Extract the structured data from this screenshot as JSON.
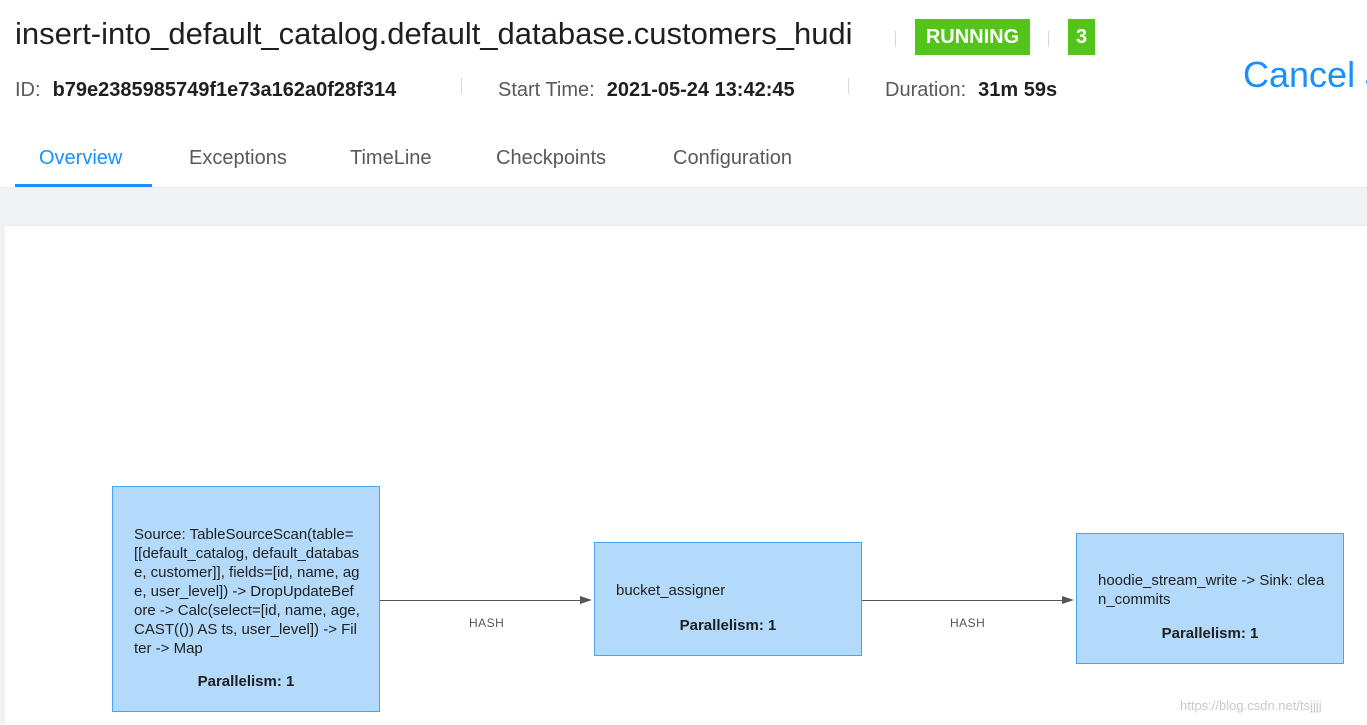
{
  "job": {
    "title": "insert-into_default_catalog.default_database.customers_hudi",
    "status": "RUNNING",
    "task_count": "3",
    "id_label": "ID:",
    "id_value": "b79e2385985749f1e73a162a0f28f314",
    "start_label": "Start Time:",
    "start_value": "2021-05-24 13:42:45",
    "duration_label": "Duration:",
    "duration_value": "31m 59s",
    "cancel_label": "Cancel J"
  },
  "colors": {
    "accent": "#1890ff",
    "running": "#52c41a",
    "node_fill": "#b3d9fb",
    "node_border": "#4aa3f0"
  },
  "tabs": [
    {
      "label": "Overview",
      "active": true
    },
    {
      "label": "Exceptions",
      "active": false
    },
    {
      "label": "TimeLine",
      "active": false
    },
    {
      "label": "Checkpoints",
      "active": false
    },
    {
      "label": "Configuration",
      "active": false
    }
  ],
  "graph": {
    "nodes": [
      {
        "description": "Source: TableSourceScan(table=[[default_catalog, default_database, customer]], fields=[id, name, age, user_level]) -> DropUpdateBefore -> Calc(select=[id, name, age, CAST(()) AS ts, user_level]) -> Filter -> Map",
        "parallelism": "Parallelism: 1"
      },
      {
        "description": "bucket_assigner",
        "parallelism": "Parallelism: 1"
      },
      {
        "description": "hoodie_stream_write -> Sink: clean_commits",
        "parallelism": "Parallelism: 1"
      }
    ],
    "edges": [
      {
        "label": "HASH"
      },
      {
        "label": "HASH"
      }
    ]
  },
  "watermark": "https://blog.csdn.net/tsjjjj"
}
